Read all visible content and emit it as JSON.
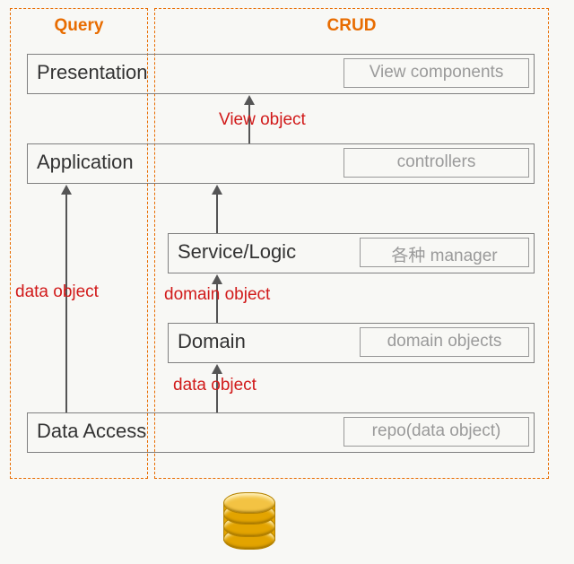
{
  "columns": {
    "query": "Query",
    "crud": "CRUD"
  },
  "layers": {
    "presentation": {
      "name": "Presentation",
      "tag": "View components"
    },
    "application": {
      "name": "Application",
      "tag": "controllers"
    },
    "service": {
      "name": "Service/Logic",
      "tag": "各种 manager"
    },
    "domain": {
      "name": "Domain",
      "tag": "domain objects"
    },
    "data_access": {
      "name": "Data Access",
      "tag": "repo(data object)"
    }
  },
  "flows": {
    "pres_app": "View object",
    "service_domain": "domain object",
    "domain_data": "data object",
    "query_left": "data object"
  }
}
